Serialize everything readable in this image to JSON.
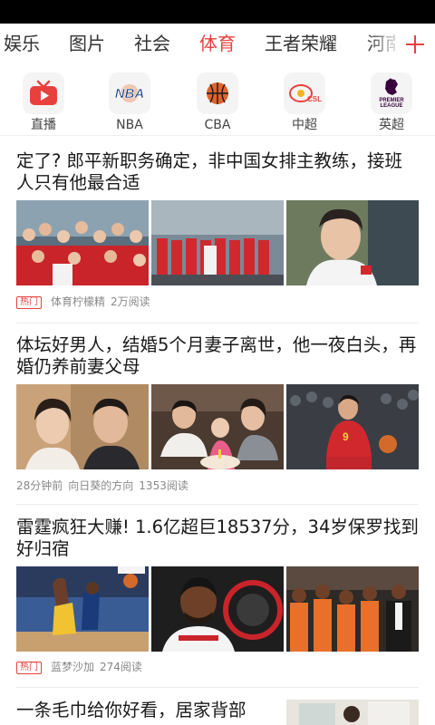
{
  "tabs": [
    {
      "label": "娱乐",
      "active": false
    },
    {
      "label": "图片",
      "active": false
    },
    {
      "label": "社会",
      "active": false
    },
    {
      "label": "体育",
      "active": true
    },
    {
      "label": "王者荣耀",
      "active": false
    },
    {
      "label": "河南",
      "active": false
    }
  ],
  "channels": [
    {
      "label": "直播",
      "icon": "live-tv-icon"
    },
    {
      "label": "NBA",
      "icon": "nba-logo-icon"
    },
    {
      "label": "CBA",
      "icon": "basketball-icon"
    },
    {
      "label": "中超",
      "icon": "csl-logo-icon"
    },
    {
      "label": "英超",
      "icon": "premier-league-logo-icon"
    }
  ],
  "channel_logo_text": {
    "nba": "NBA",
    "csl": "CSL",
    "pl_line1": "PREMIER",
    "pl_line2": "LEAGUE"
  },
  "articles": [
    {
      "title": "定了? 郎平新职务确定，非中国女排主教练，接班人只有他最合适",
      "hot": "热门",
      "source": "体育柠檬精",
      "reads": "2万阅读"
    },
    {
      "title": "体坛好男人，结婚5个月妻子离世，他一夜白头，再婚仍养前妻父母",
      "time": "28分钟前",
      "source": "向日葵的方向",
      "reads": "1353阅读"
    },
    {
      "title": "雷霆疯狂大赚! 1.6亿超巨18537分，34岁保罗找到好归宿",
      "hot": "热门",
      "source": "蓝梦沙加",
      "reads": "274阅读"
    },
    {
      "title": "一条毛巾给你好看，居家背部"
    }
  ],
  "colors": {
    "accent": "#e8413d",
    "text": "#1a1a1a",
    "meta": "#888888"
  }
}
